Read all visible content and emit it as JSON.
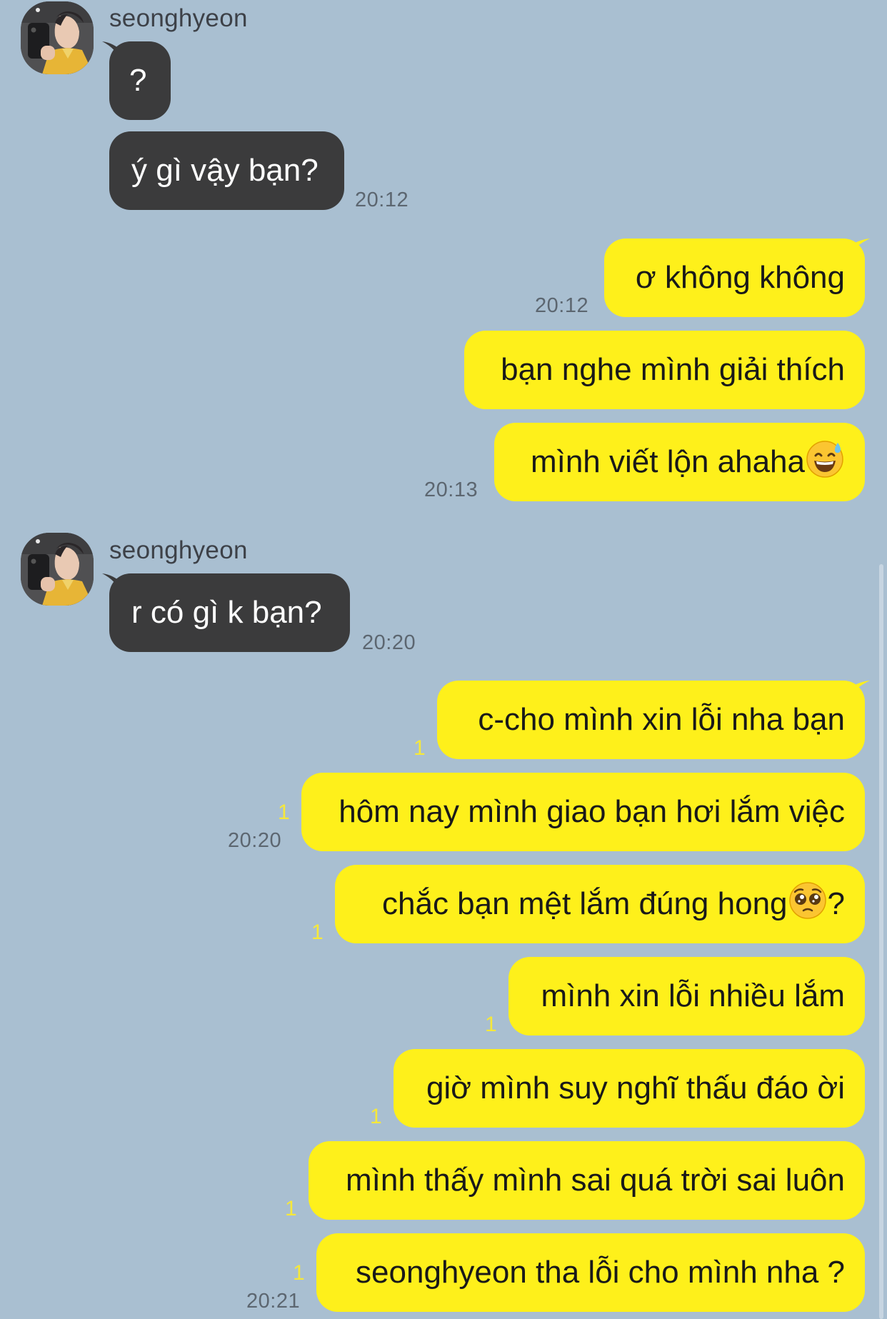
{
  "chat": {
    "sender_name": "seonghyeon",
    "group1": {
      "msg1": "?",
      "msg2": "ý gì vậy bạn?",
      "time": "20:12"
    },
    "group2": {
      "msg1": "ơ không không",
      "time1": "20:12",
      "msg2": "bạn nghe mình giải thích",
      "msg3": "mình viết lộn ahaha",
      "msg3_emoji": "sweat-smile-emoji",
      "time2": "20:13"
    },
    "group3": {
      "msg1": "r có gì k bạn?",
      "time": "20:20"
    },
    "group4": {
      "msg1": "c-cho mình xin lỗi nha bạn",
      "msg1_unread": "1",
      "msg2": "hôm nay mình giao bạn hơi lắm việc",
      "msg2_unread": "1",
      "time1": "20:20",
      "msg3_before": "chắc bạn mệt lắm đúng hong",
      "msg3_emoji": "pleading-face-emoji",
      "msg3_after": "?",
      "msg3_unread": "1",
      "msg4": "mình xin lỗi nhiều lắm",
      "msg4_unread": "1",
      "msg5": "giờ mình suy nghĩ thấu đáo ời",
      "msg5_unread": "1",
      "msg6": "mình thấy mình sai quá trời sai luôn",
      "msg6_unread": "1",
      "msg7": "seonghyeon tha lỗi cho mình nha ?",
      "msg7_unread": "1",
      "time2": "20:21"
    }
  },
  "colors": {
    "background": "#a9bfd1",
    "incoming_bubble": "#3b3b3c",
    "outgoing_bubble": "#fef01b",
    "unread_count": "#f6e83a"
  }
}
